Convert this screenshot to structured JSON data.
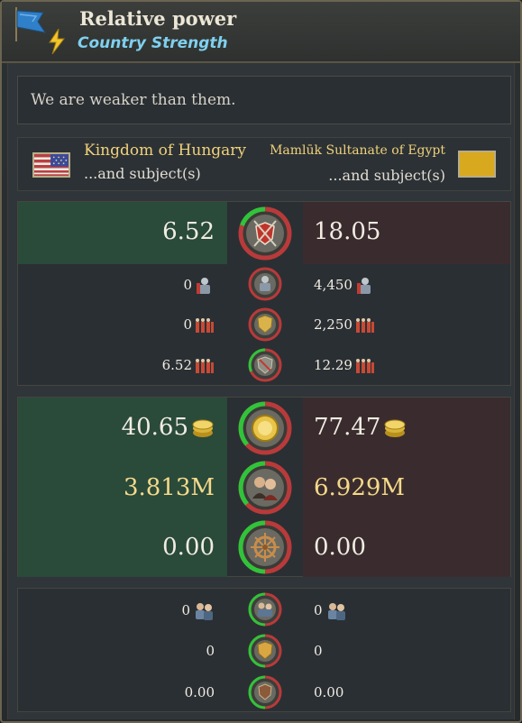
{
  "header": {
    "title": "Relative power",
    "subtitle": "Country Strength"
  },
  "message": "We are weaker than them.",
  "countries": {
    "left": {
      "name": "Kingdom of Hungary",
      "sub": "...and subject(s)"
    },
    "right": {
      "name": "Mamlūk Sultanate of Egypt",
      "sub": "...and subject(s)"
    }
  },
  "military": {
    "total": {
      "left": "6.52",
      "right": "18.05",
      "share_left": 0.27
    },
    "rows": [
      {
        "left": "0",
        "right": "4,450",
        "icon": "soldier-icon",
        "share_left": 0.0
      },
      {
        "left": "0",
        "right": "2,250",
        "icon": "army-icon",
        "share_left": 0.0
      },
      {
        "left": "6.52",
        "right": "12.29",
        "icon": "army-icon",
        "share_left": 0.35
      }
    ]
  },
  "economy": {
    "rows": [
      {
        "left": "40.65",
        "right": "77.47",
        "icon": "gold-coins-icon",
        "share_left": 0.34
      },
      {
        "left": "3.813M",
        "right": "6.929M",
        "icon": "population-icon",
        "share_left": 0.35
      },
      {
        "left": "0.00",
        "right": "0.00",
        "icon": "ship-wheel-icon",
        "share_left": 0.5
      }
    ]
  },
  "diplomacy": {
    "rows": [
      {
        "left": "0",
        "right": "0",
        "icon": "people-icon",
        "share_left": 0.5
      },
      {
        "left": "0",
        "right": "0",
        "icon": "shield-icon",
        "share_left": 0.5
      },
      {
        "left": "0.00",
        "right": "0.00",
        "icon": "shield-icon",
        "share_left": 0.5
      }
    ]
  },
  "colors": {
    "ours": "#2fc43a",
    "theirs": "#b93a3a",
    "left_bg": "#2a4a3a",
    "right_bg": "#3a2c2e"
  }
}
